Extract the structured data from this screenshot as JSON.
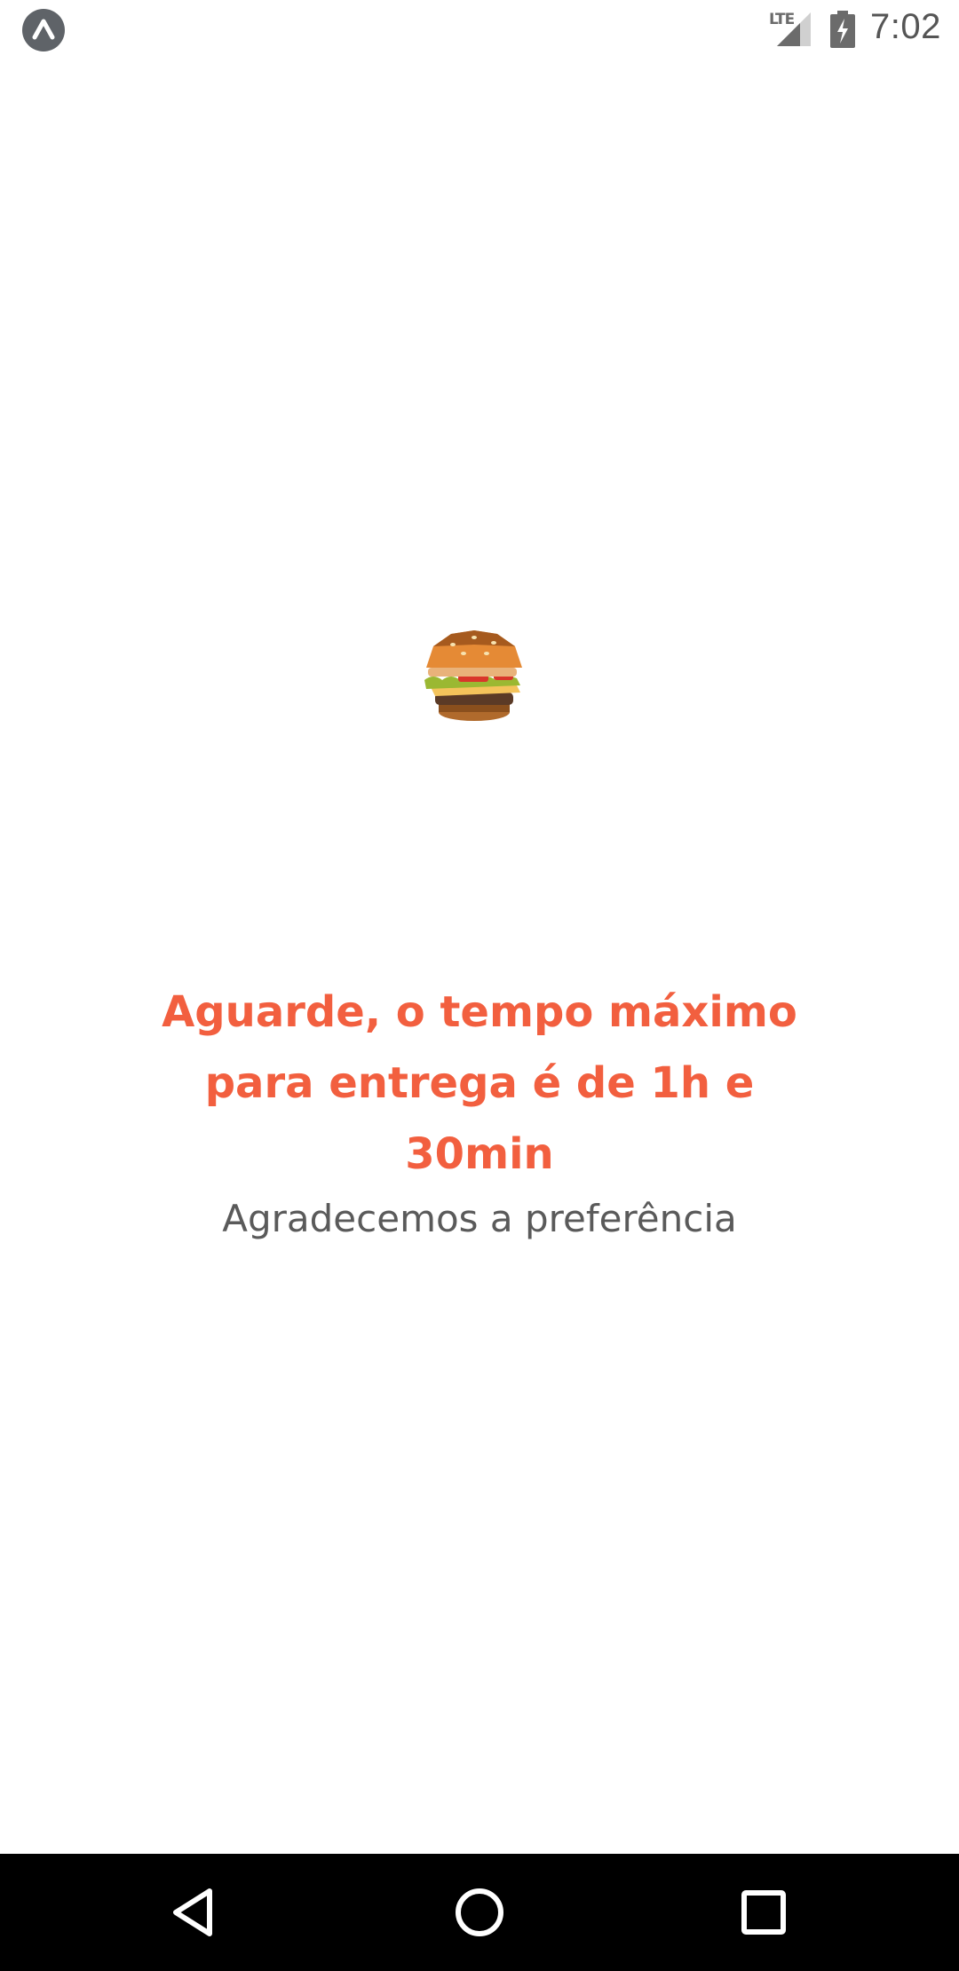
{
  "status_bar": {
    "network": "LTE",
    "time": "7:02",
    "app_icon": "expo-logo-icon",
    "signal_icon": "cell-signal-icon",
    "battery_icon": "battery-charging-icon"
  },
  "main": {
    "image": "burger-icon",
    "headline": "Aguarde, o tempo máximo para entrega é de 1h e 30min",
    "subline": "Agradecemos a preferência",
    "colors": {
      "headline": "#f25f3f",
      "subline": "#5a5a5a"
    }
  },
  "nav_bar": {
    "back_icon": "back-triangle-icon",
    "home_icon": "home-circle-icon",
    "recents_icon": "recents-square-icon"
  }
}
